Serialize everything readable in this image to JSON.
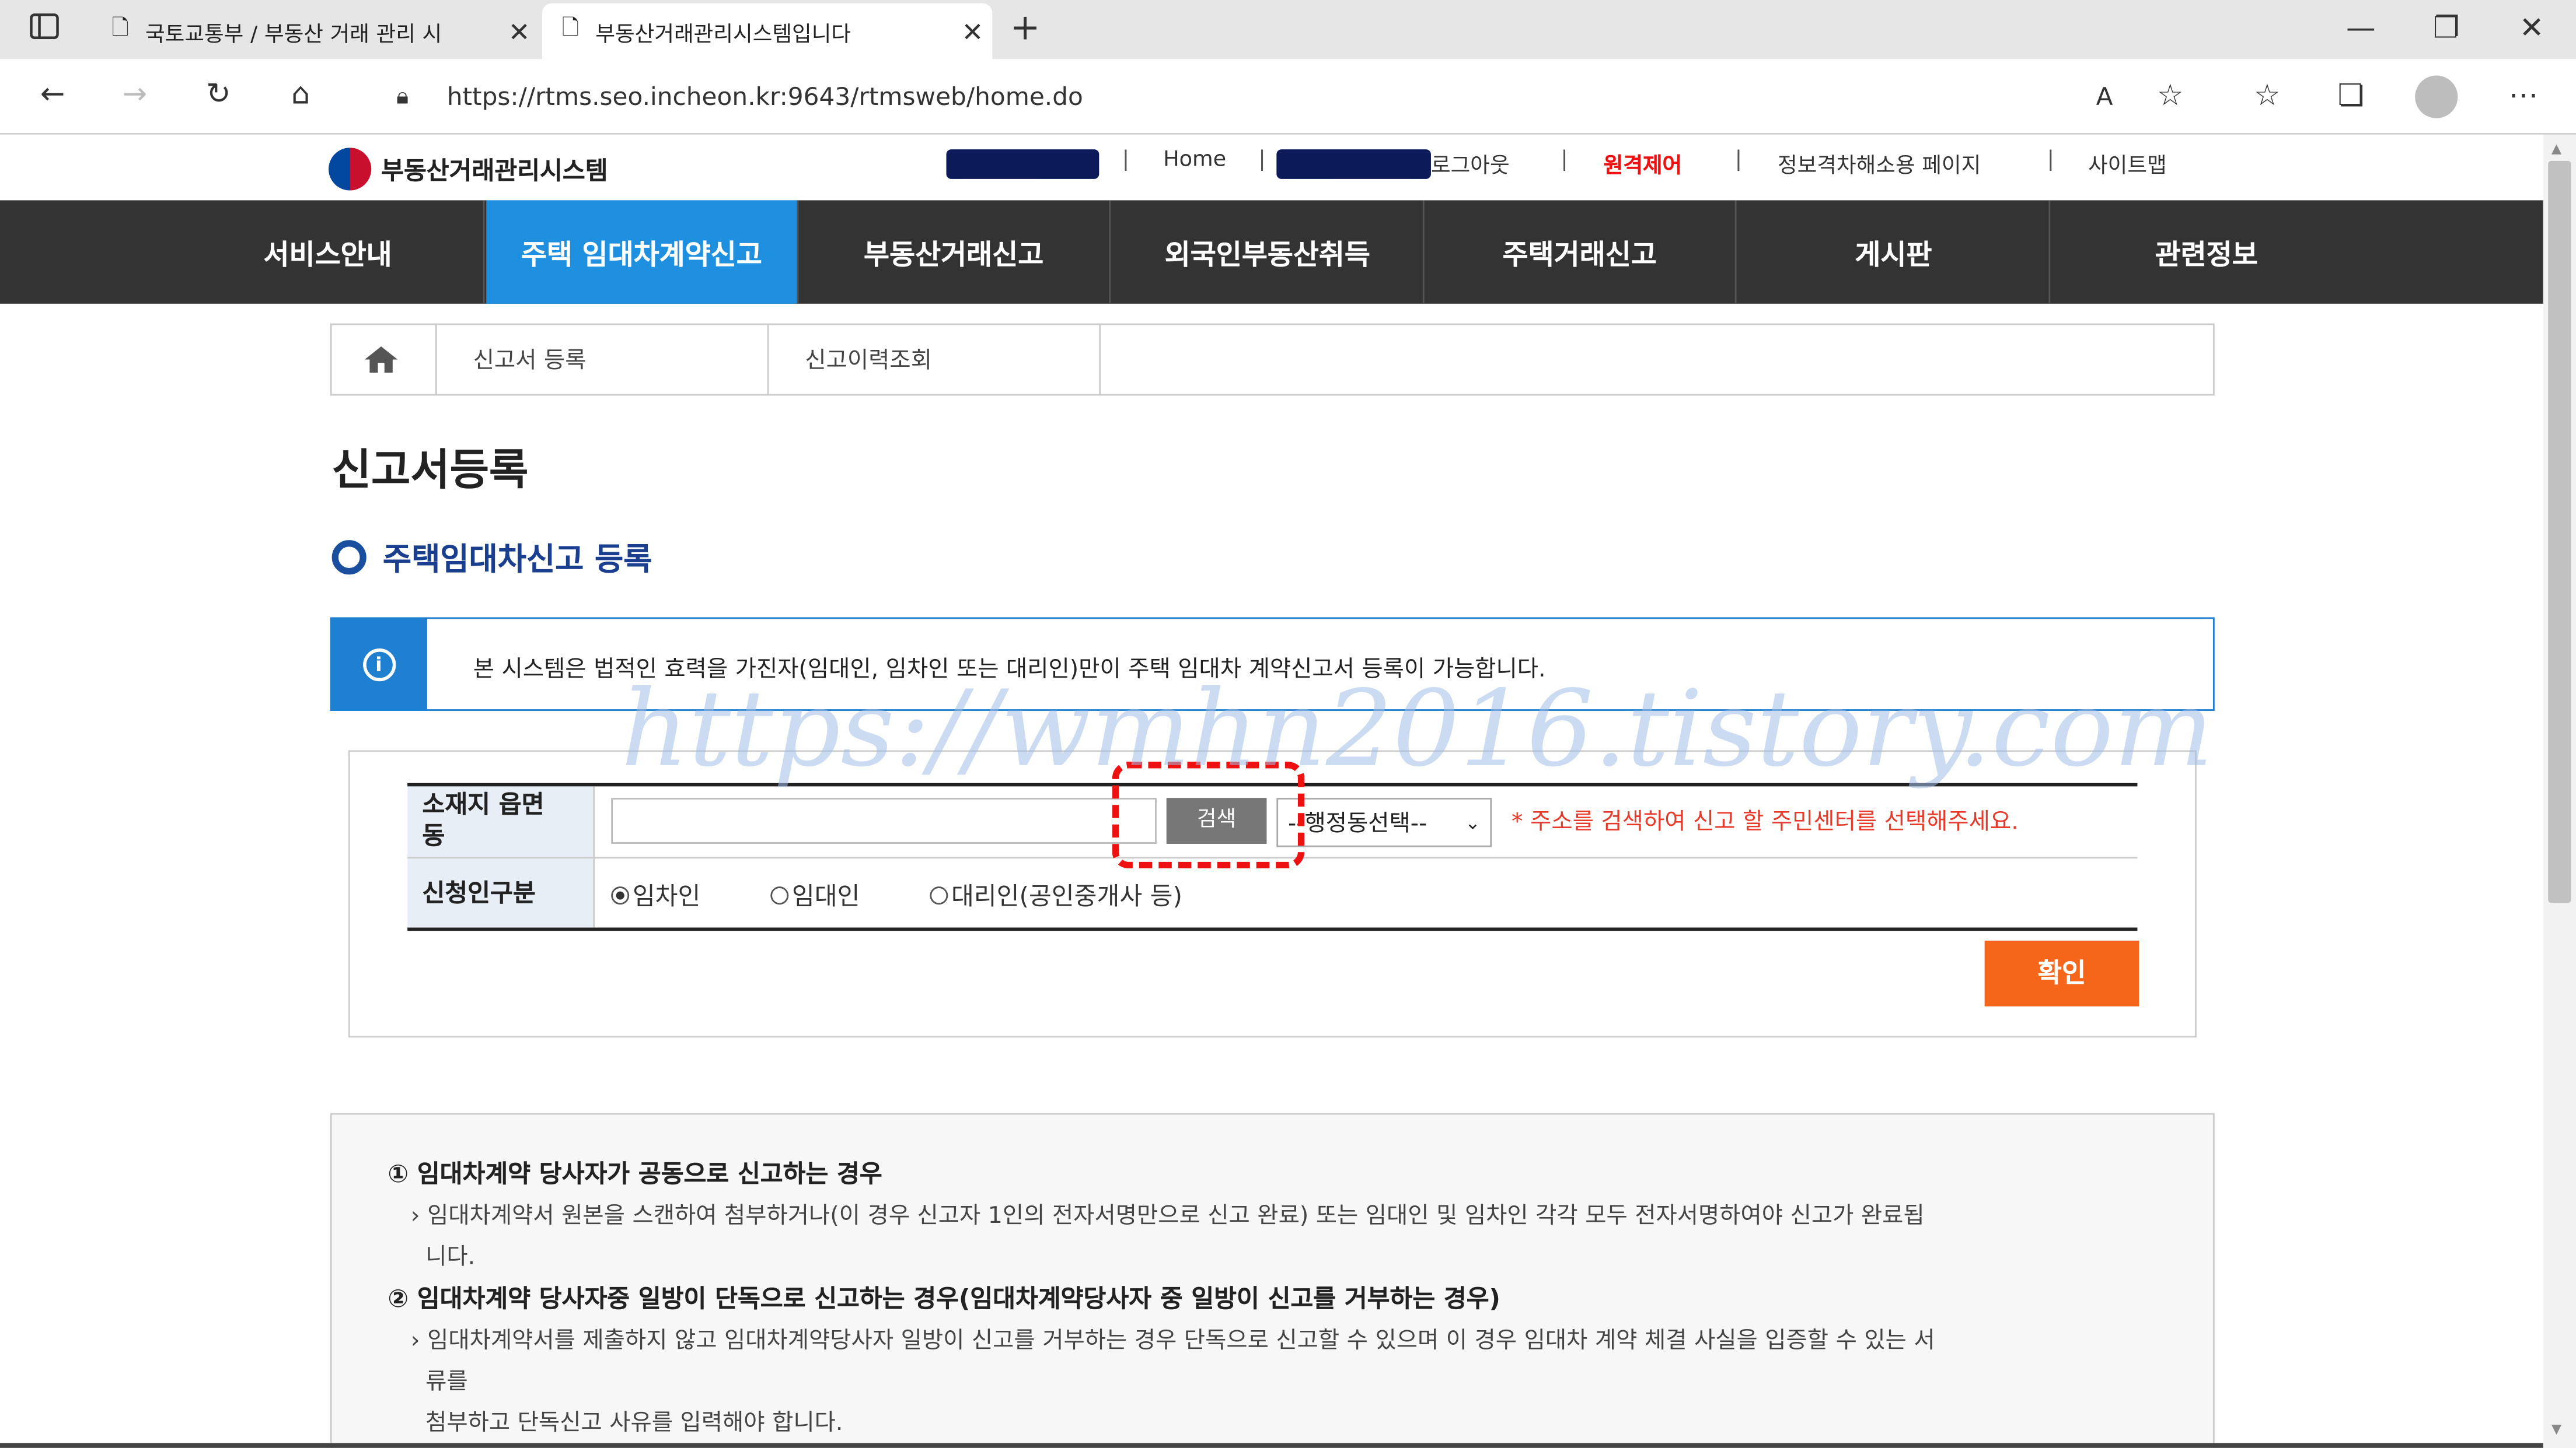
{
  "browser": {
    "tabs": [
      {
        "title": "국토교통부 / 부동산 거래 관리 시"
      },
      {
        "title": "부동산거래관리시스템입니다"
      }
    ],
    "url": "https://rtms.seo.incheon.kr:9643/rtmsweb/home.do"
  },
  "site": {
    "logo_text": "부동산거래관리시스템",
    "top_links": {
      "home": "Home",
      "logout": "로그아웃",
      "remote": "원격제어",
      "accessibility": "정보격차해소용 페이지",
      "sitemap": "사이트맵"
    },
    "nav": [
      "서비스안내",
      "주택 임대차계약신고",
      "부동산거래신고",
      "외국인부동산취득",
      "주택거래신고",
      "게시판",
      "관련정보"
    ],
    "breadcrumb": [
      "신고서 등록",
      "신고이력조회"
    ],
    "page_title": "신고서등록",
    "section_title": "주택임대차신고 등록",
    "notice": "본 시스템은 법적인 효력을 가진자(임대인, 임차인 또는 대리인)만이 주택 임대차 계약신고서 등록이 가능합니다.",
    "watermark": "https://wmhn2016.tistory.com",
    "form": {
      "location_label_1": "소재지 읍면",
      "location_label_2": "동",
      "search_button": "검색",
      "dong_select": "--행정동선택--",
      "hint": "* 주소를 검색하여 신고 할 주민센터를 선택해주세요.",
      "applicant_label": "신청인구분",
      "options": [
        "임차인",
        "임대인",
        "대리인(공인중개사 등)"
      ],
      "selected_option": "임차인",
      "ok_button": "확인"
    },
    "guide": {
      "item1_title": "① 임대차계약 당사자가 공동으로 신고하는 경우",
      "item1_line1": "› 임대차계약서 원본을 스캔하여 첨부하거나(이 경우 신고자 1인의 전자서명만으로 신고 완료) 또는 임대인 및 임차인 각각 모두 전자서명하여야 신고가 완료됩",
      "item1_line2": "니다.",
      "item2_title": "② 임대차계약 당사자중 일방이 단독으로 신고하는 경우(임대차계약당사자 중 일방이 신고를 거부하는 경우)",
      "item2_line1": "› 임대차계약서를 제출하지 않고 임대차계약당사자 일방이 신고를 거부하는 경우 단독으로 신고할 수 있으며 이 경우 임대차 계약 체결 사실을 입증할 수 있는 서",
      "item2_line2": "류를",
      "item2_line3": "첨부하고 단독신고 사유를 입력해야 합니다."
    }
  },
  "colors": {
    "nav_bg": "#333333",
    "nav_active": "#1f8fe0",
    "ok_button": "#f5661a",
    "hint": "#e83a2a",
    "notice_border": "#1f7fd0"
  }
}
